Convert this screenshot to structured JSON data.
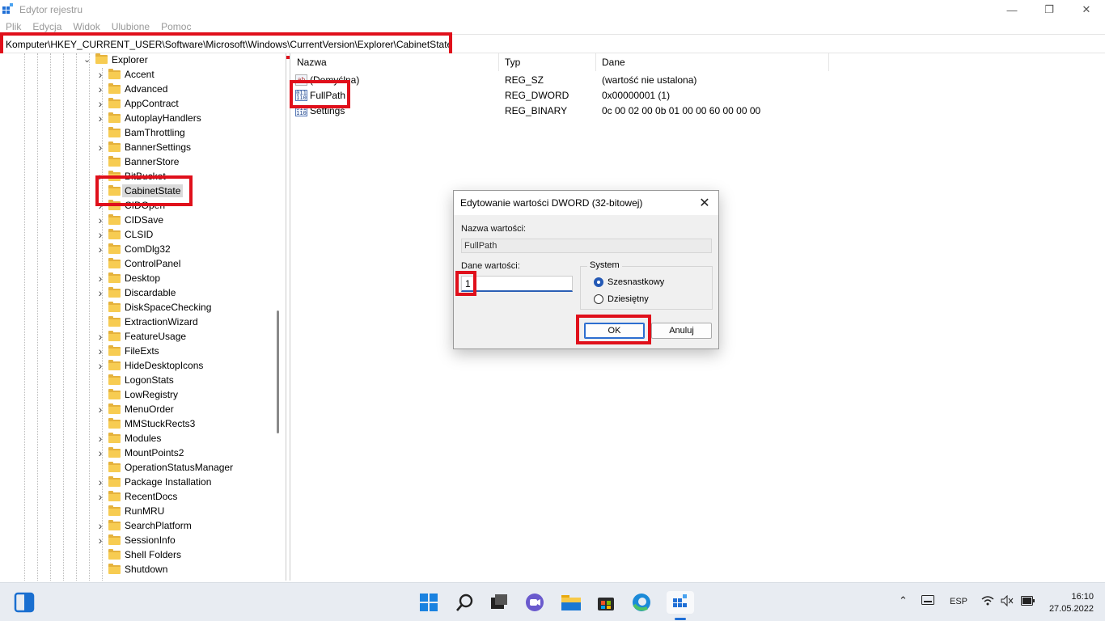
{
  "window": {
    "title": "Edytor rejestru",
    "minimize_glyph": "—",
    "restore_glyph": "❐",
    "close_glyph": "✕"
  },
  "menu": [
    "Plik",
    "Edycja",
    "Widok",
    "Ulubione",
    "Pomoc"
  ],
  "address": "Komputer\\HKEY_CURRENT_USER\\Software\\Microsoft\\Windows\\CurrentVersion\\Explorer\\CabinetState",
  "tree": {
    "parent": "Explorer",
    "items": [
      {
        "label": "Accent",
        "expandable": true
      },
      {
        "label": "Advanced",
        "expandable": true
      },
      {
        "label": "AppContract",
        "expandable": true
      },
      {
        "label": "AutoplayHandlers",
        "expandable": true
      },
      {
        "label": "BamThrottling",
        "expandable": false
      },
      {
        "label": "BannerSettings",
        "expandable": true
      },
      {
        "label": "BannerStore",
        "expandable": false
      },
      {
        "label": "BitBucket",
        "expandable": true
      },
      {
        "label": "CabinetState",
        "expandable": false,
        "selected": true
      },
      {
        "label": "CIDOpen",
        "expandable": true
      },
      {
        "label": "CIDSave",
        "expandable": true
      },
      {
        "label": "CLSID",
        "expandable": true
      },
      {
        "label": "ComDlg32",
        "expandable": true
      },
      {
        "label": "ControlPanel",
        "expandable": false
      },
      {
        "label": "Desktop",
        "expandable": true
      },
      {
        "label": "Discardable",
        "expandable": true
      },
      {
        "label": "DiskSpaceChecking",
        "expandable": false
      },
      {
        "label": "ExtractionWizard",
        "expandable": false
      },
      {
        "label": "FeatureUsage",
        "expandable": true
      },
      {
        "label": "FileExts",
        "expandable": true
      },
      {
        "label": "HideDesktopIcons",
        "expandable": true
      },
      {
        "label": "LogonStats",
        "expandable": false
      },
      {
        "label": "LowRegistry",
        "expandable": false
      },
      {
        "label": "MenuOrder",
        "expandable": true
      },
      {
        "label": "MMStuckRects3",
        "expandable": false
      },
      {
        "label": "Modules",
        "expandable": true
      },
      {
        "label": "MountPoints2",
        "expandable": true
      },
      {
        "label": "OperationStatusManager",
        "expandable": false
      },
      {
        "label": "Package Installation",
        "expandable": true
      },
      {
        "label": "RecentDocs",
        "expandable": true
      },
      {
        "label": "RunMRU",
        "expandable": false
      },
      {
        "label": "SearchPlatform",
        "expandable": true
      },
      {
        "label": "SessionInfo",
        "expandable": true
      },
      {
        "label": "Shell Folders",
        "expandable": false
      },
      {
        "label": "Shutdown",
        "expandable": false
      }
    ]
  },
  "list": {
    "columns": [
      "Nazwa",
      "Typ",
      "Dane"
    ],
    "rows": [
      {
        "name": "(Domyślna)",
        "type": "REG_SZ",
        "data": "(wartość nie ustalona)",
        "icon": "string-value-icon"
      },
      {
        "name": "FullPath",
        "type": "REG_DWORD",
        "data": "0x00000001 (1)",
        "icon": "binary-value-icon"
      },
      {
        "name": "Settings",
        "type": "REG_BINARY",
        "data": "0c 00 02 00 0b 01 00 00 60 00 00 00",
        "icon": "binary-value-icon"
      }
    ]
  },
  "dialog": {
    "title": "Edytowanie wartości DWORD (32-bitowej)",
    "close_glyph": "✕",
    "name_label": "Nazwa wartości:",
    "name_value": "FullPath",
    "data_label": "Dane wartości:",
    "data_value": "1",
    "base_label": "System",
    "base_hex": "Szesnastkowy",
    "base_dec": "Dziesiętny",
    "selected_base": "hex",
    "ok_label": "OK",
    "cancel_label": "Anuluj"
  },
  "taskbar": {
    "lang": "ESP",
    "time": "16:10",
    "date": "27.05.2022"
  },
  "colors": {
    "highlight": "#e0101b",
    "accent": "#2459b5",
    "folder": "#f7cc52"
  }
}
